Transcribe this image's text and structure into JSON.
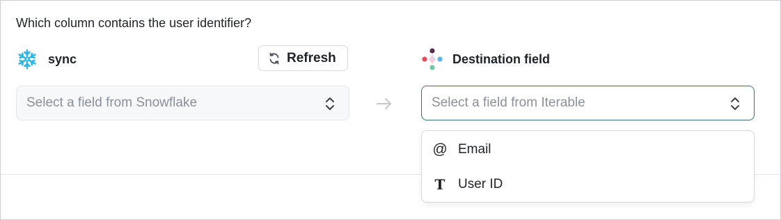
{
  "question": "Which column contains the user identifier?",
  "source": {
    "name": "sync",
    "logo_icon": "snowflake-icon",
    "refresh_label": "Refresh",
    "refresh_icon": "refresh-icon",
    "select_placeholder": "Select a field from Snowflake"
  },
  "destination": {
    "name": "Destination field",
    "logo_icon": "iterable-logo-icon",
    "select_placeholder": "Select a field from Iterable",
    "options": [
      {
        "icon": "at-sign-icon",
        "glyph": "@",
        "label": "Email"
      },
      {
        "icon": "text-type-icon",
        "glyph": "T",
        "label": "User ID"
      }
    ]
  },
  "colors": {
    "snowflake": "#29b5e8",
    "accent_border": "#3d6f7a",
    "placeholder": "#8a9099"
  }
}
